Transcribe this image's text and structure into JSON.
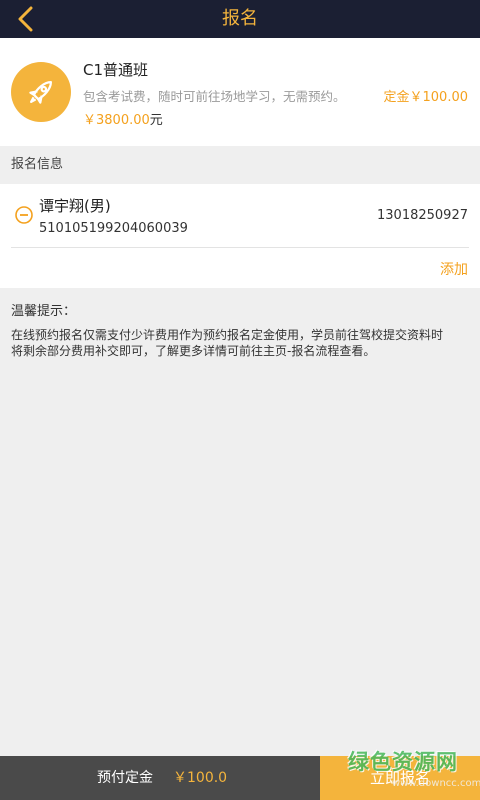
{
  "header": {
    "title": "报名"
  },
  "course": {
    "name": "C1普通班",
    "description": "包含考试费，随时可前往场地学习，无需预约。",
    "price": "￥3800.00",
    "price_unit": "元",
    "deposit": "定金￥100.00"
  },
  "applicant_section": {
    "title": "报名信息"
  },
  "applicant": {
    "name": "谭宇翔(男)",
    "id_number": "510105199204060039",
    "phone": "13018250927"
  },
  "add_label": "添加",
  "tips": {
    "title": "温馨提示：",
    "body": "在线预约报名仅需支付少许费用作为预约报名定金使用，学员前往驾校提交资料时将剩余部分费用补交即可，了解更多详情可前往主页-报名流程查看。"
  },
  "footer": {
    "deposit_label": "预付定金",
    "deposit_amount": "￥100.0",
    "submit_label": "立即报名"
  },
  "watermark": {
    "text": "绿色资源网",
    "url": "www.downcc.com"
  },
  "colors": {
    "accent": "#f4b43c",
    "topbar": "#1b1f33",
    "bottombar": "#4a4a4a"
  }
}
